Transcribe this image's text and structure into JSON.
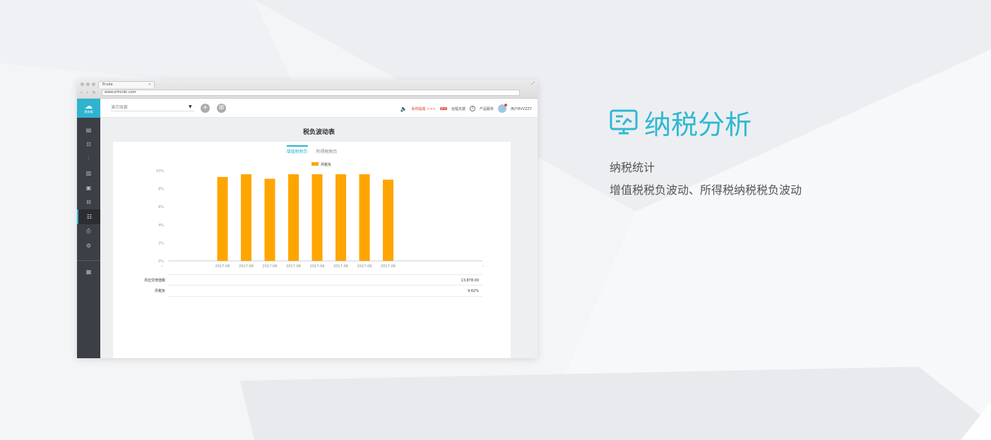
{
  "colors": {
    "accent": "#2fb8d3",
    "bar": "#ffa500",
    "sidebar": "#3c3f45"
  },
  "browser": {
    "tab_title": "Eruda",
    "url": "www.erhcrdc.com"
  },
  "app": {
    "logo_text": "税务猫",
    "account_placeholder": "演示账套",
    "top_right": {
      "notice": "系统提醒 >>>",
      "service": "远程支援",
      "help": "产品服务",
      "user": "用户BVVZZY"
    },
    "sidebar_icons": [
      "ledger-icon",
      "upload-icon",
      "chart-icon",
      "document-icon",
      "invoice-icon",
      "report-icon",
      "tax-analysis-icon",
      "print-icon",
      "settings-icon",
      "archive-icon"
    ],
    "page_title": "税负波动表",
    "tabs": [
      {
        "label": "增值税税负",
        "active": true
      },
      {
        "label": "所得税税负",
        "active": false
      }
    ],
    "summary": [
      {
        "label": "月应交增值税",
        "value": "13,878.00"
      },
      {
        "label": "月税负",
        "value": "9.62%"
      }
    ]
  },
  "chart_data": {
    "type": "bar",
    "legend": "月税负",
    "legend_position": "top-center",
    "categories": [
      "2017-06",
      "2017-06",
      "2017-06",
      "2017-06",
      "2017-06",
      "2017-06",
      "2017-06",
      "2017-06"
    ],
    "values": [
      9.3,
      9.6,
      9.1,
      9.6,
      9.6,
      9.6,
      9.6,
      9.0
    ],
    "y_ticks": [
      "0%",
      "2%",
      "4%",
      "6%",
      "8%",
      "10%"
    ],
    "ylim": [
      0,
      10
    ],
    "grid": false
  },
  "promo": {
    "title": "纳税分析",
    "line1": "纳税统计",
    "line2": "增值税税负波动、所得税纳税税负波动"
  }
}
